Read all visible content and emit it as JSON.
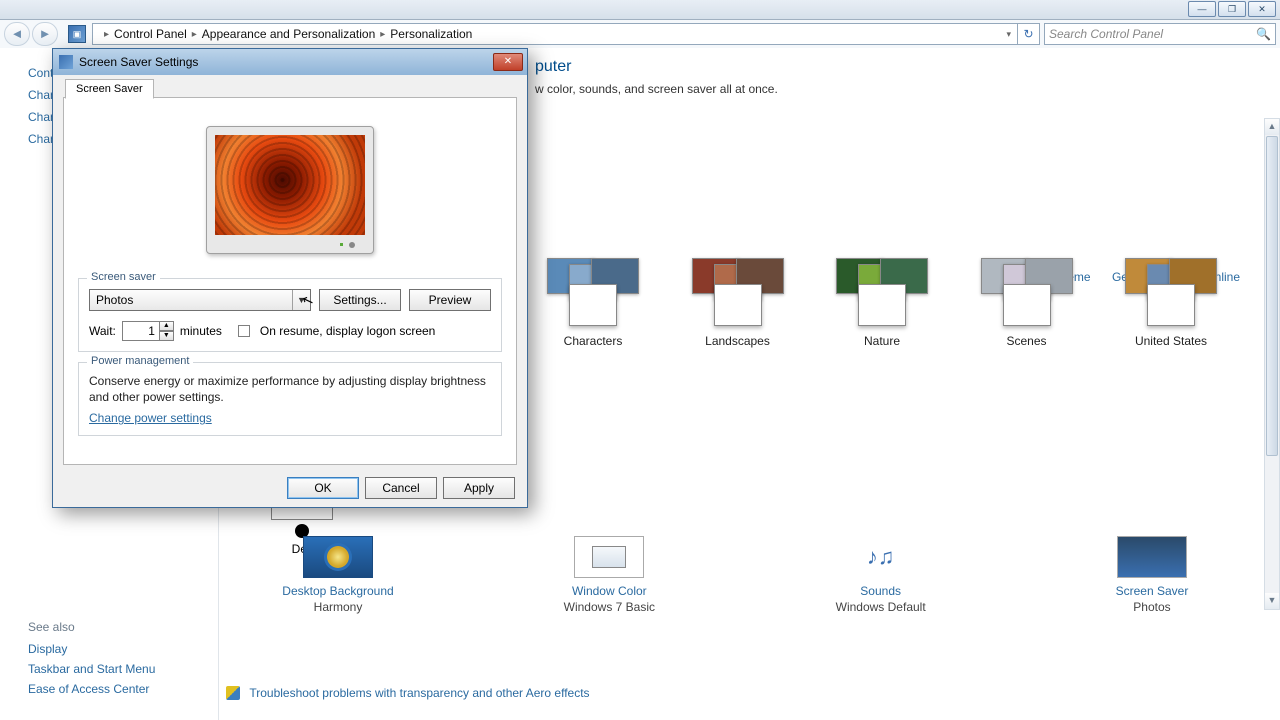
{
  "window": {
    "min_caption": "—",
    "max_caption": "❐",
    "close_caption": "✕"
  },
  "breadcrumb": {
    "root": "Control Panel",
    "level1": "Appearance and Personalization",
    "level2": "Personalization"
  },
  "search_placeholder": "Search Control Panel",
  "sidebar_top": {
    "item0": "Control Panel Home",
    "item1": "Change desktop icons",
    "item2": "Change mouse pointers",
    "item3": "Change your account picture"
  },
  "sidebar_bottom": {
    "header": "See also",
    "link0": "Display",
    "link1": "Taskbar and Start Menu",
    "link2": "Ease of Access Center"
  },
  "main": {
    "heading_suffix": "puter",
    "heading_full": "Change the visuals and sounds on your computer",
    "sub_suffix": "w color, sounds, and screen saver all at once.",
    "save_theme": "Save theme",
    "get_more": "Get more themes online"
  },
  "themes": {
    "t0": "Characters",
    "t1": "Landscapes",
    "t2": "Nature",
    "t3": "Scenes",
    "t4": "United States"
  },
  "dell_label": "Dell",
  "bottom": {
    "db_title": "Desktop Background",
    "db_value": "Harmony",
    "wc_title": "Window Color",
    "wc_value": "Windows 7 Basic",
    "sn_title": "Sounds",
    "sn_value": "Windows Default",
    "ss_title": "Screen Saver",
    "ss_value": "Photos"
  },
  "troubleshoot": "Troubleshoot problems with transparency and other Aero effects",
  "dialog": {
    "title": "Screen Saver Settings",
    "tab": "Screen Saver",
    "legend_ss": "Screen saver",
    "select_value": "Photos",
    "settings_btn": "Settings...",
    "preview_btn": "Preview",
    "wait_label": "Wait:",
    "wait_value": "1",
    "minutes": "minutes",
    "resume_label": "On resume, display logon screen",
    "legend_pm": "Power management",
    "pm_text": "Conserve energy or maximize performance by adjusting display brightness and other power settings.",
    "pm_link": "Change power settings",
    "ok": "OK",
    "cancel": "Cancel",
    "apply": "Apply"
  }
}
